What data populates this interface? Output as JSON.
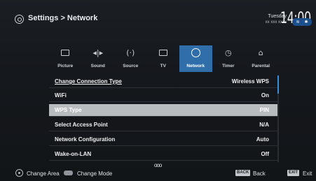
{
  "header": {
    "breadcrumb": "Settings > Network",
    "day": "Tuesday",
    "date": "xx xxx xxxx",
    "time": "14:00",
    "status_wifi": "wifi-icon",
    "status_bt": "bluetooth-icon"
  },
  "tabs": [
    {
      "label": "Picture",
      "icon": "picture-icon",
      "glyph": "▭"
    },
    {
      "label": "Sound",
      "icon": "sound-icon",
      "glyph": "◖|◗"
    },
    {
      "label": "Source",
      "icon": "source-icon",
      "glyph": "((·))"
    },
    {
      "label": "TV",
      "icon": "tv-icon",
      "glyph": "▭"
    },
    {
      "label": "Network",
      "icon": "network-globe-icon",
      "glyph": "◎",
      "active": true
    },
    {
      "label": "Timer",
      "icon": "timer-icon",
      "glyph": "⌚"
    },
    {
      "label": "Parental",
      "icon": "parental-icon",
      "glyph": "⌂"
    }
  ],
  "settings": [
    {
      "label": "Change Connection Type",
      "value": "Wireless WPS"
    },
    {
      "label": "WiFi",
      "value": "On"
    },
    {
      "label": "WPS Type",
      "value": "PIN",
      "focused": true
    },
    {
      "label": "Select Access Point",
      "value": "N/A"
    },
    {
      "label": "Network Configuration",
      "value": "Auto"
    },
    {
      "label": "Wake-on-LAN",
      "value": "Off"
    }
  ],
  "footer": {
    "change_area": "Change Area",
    "change_mode": "Change Mode",
    "more": "ooo",
    "back_key": "BACK",
    "back_label": "Back",
    "exit_key": "EXIT",
    "exit_label": "Exit"
  },
  "colors": {
    "accent": "#2f6ea8",
    "focus_row": "#b9bcbf",
    "background": "#15181c"
  }
}
